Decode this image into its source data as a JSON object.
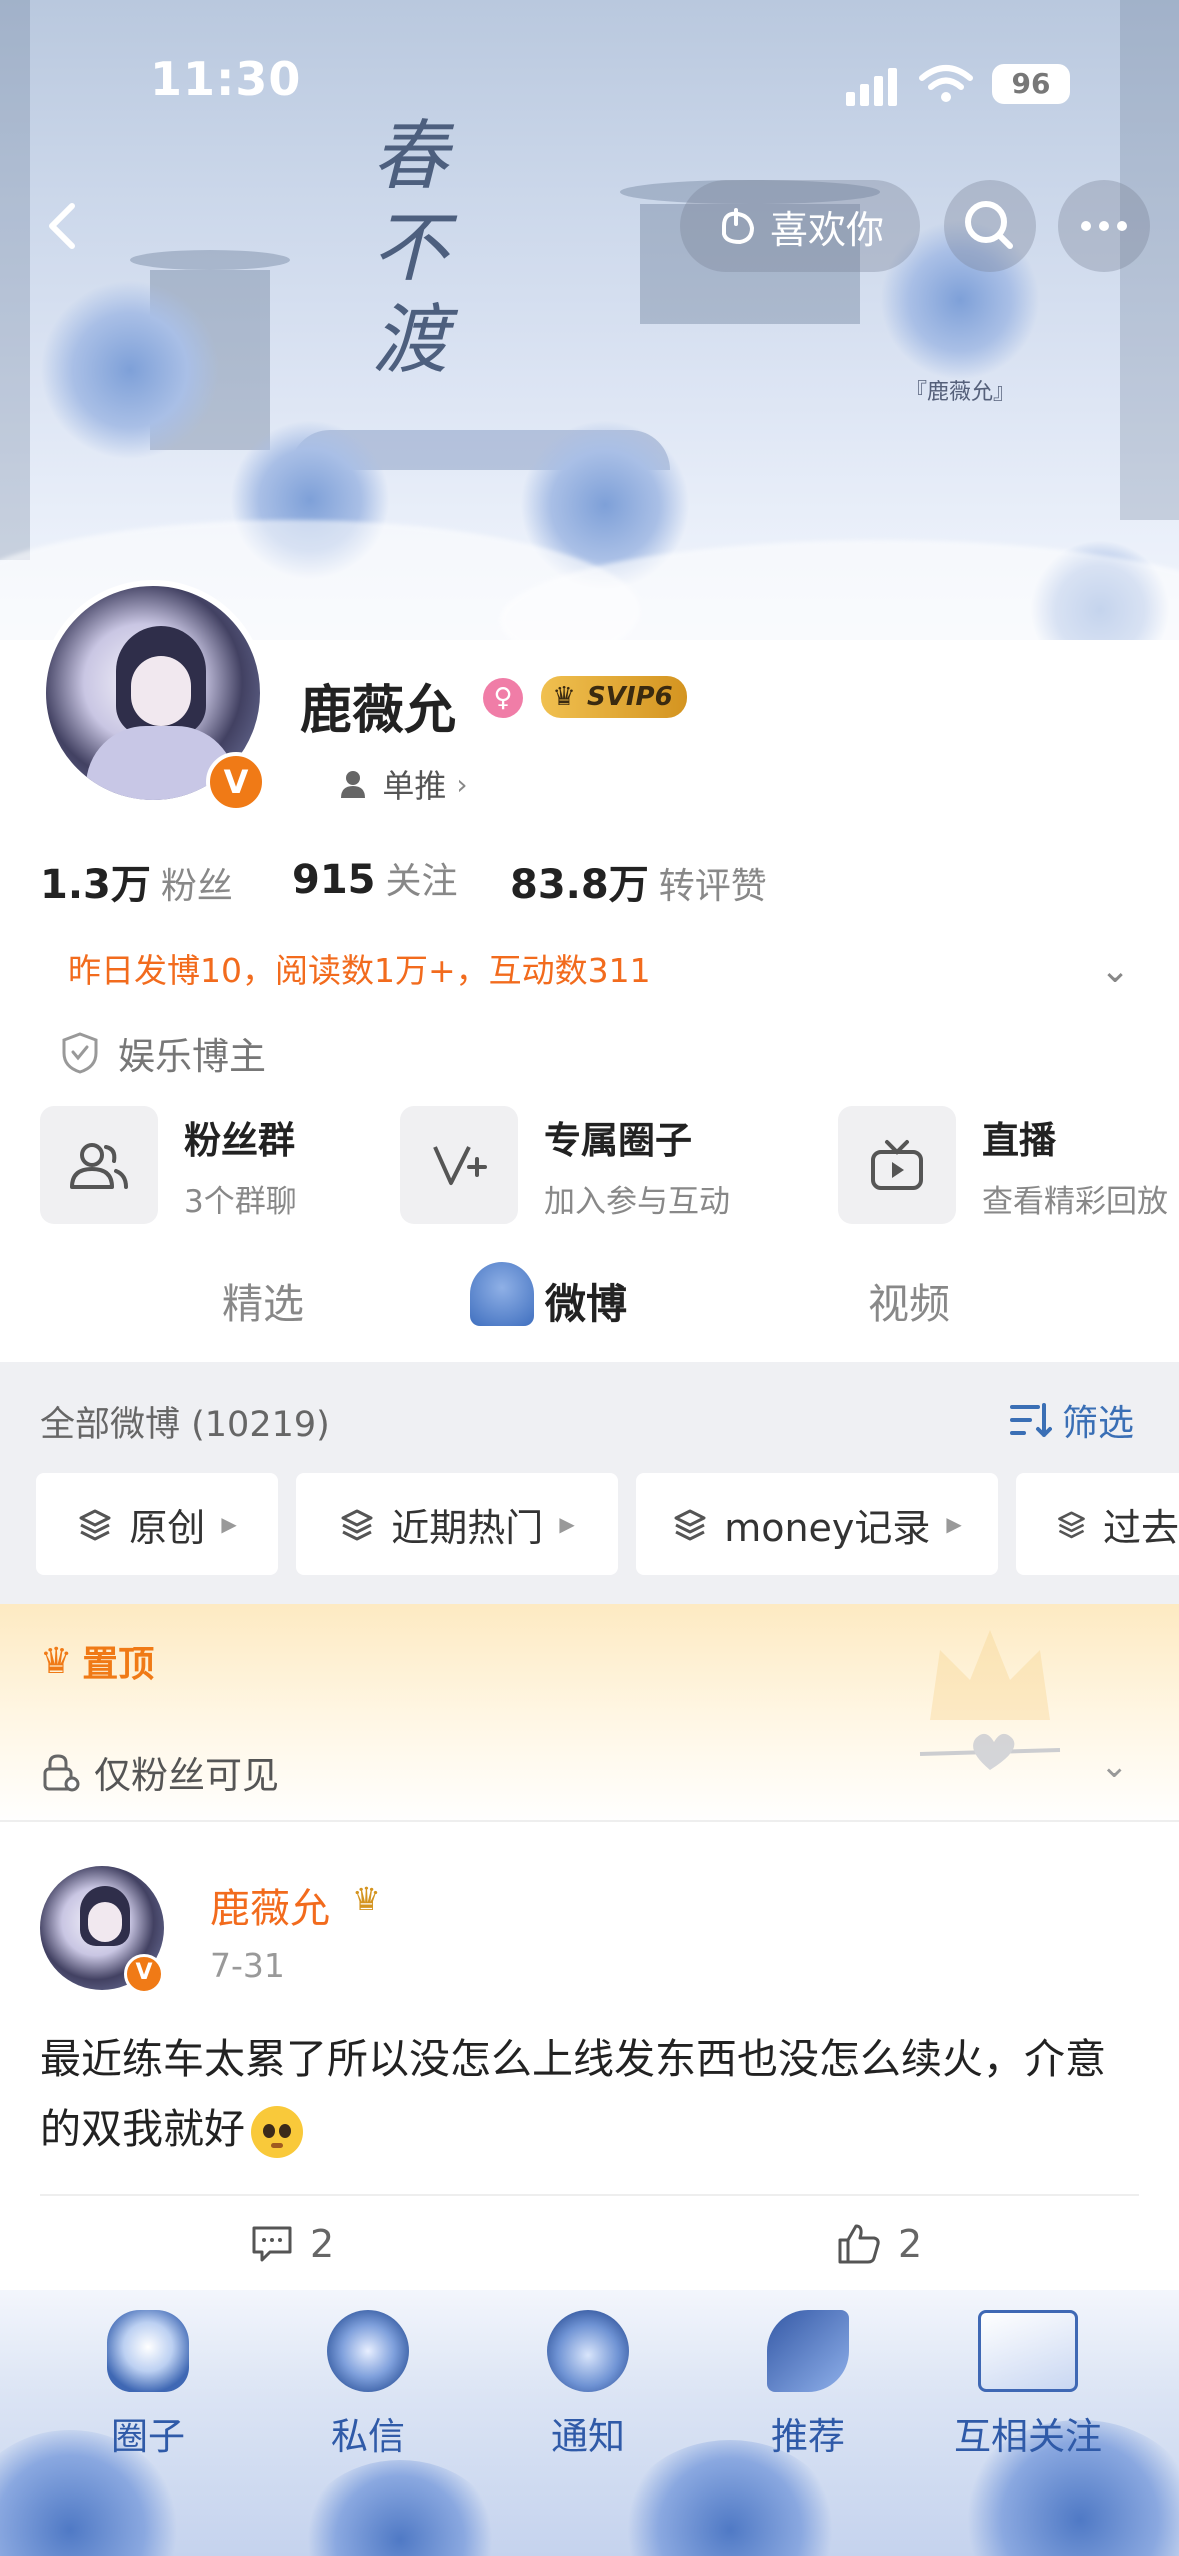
{
  "status_bar": {
    "time": "11:30",
    "battery": "96"
  },
  "header": {
    "like_label": "喜欢你"
  },
  "banner_calligraphy": {
    "title": "春不渡",
    "signature": "『鹿薇允』"
  },
  "profile": {
    "name": "鹿薇允",
    "gender_icon": "female-icon",
    "svip_label": "SVIP6",
    "single_label": "单推",
    "stats": [
      {
        "value": "1.3万",
        "label": "粉丝"
      },
      {
        "value": "915",
        "label": "关注"
      },
      {
        "value": "83.8万",
        "label": "转评赞"
      }
    ],
    "yesterday_summary": "昨日发博10，阅读数1万+，互动数311",
    "category": "娱乐博主"
  },
  "quick_actions": [
    {
      "title": "粉丝群",
      "subtitle": "3个群聊",
      "icon": "group-icon"
    },
    {
      "title": "专属圈子",
      "subtitle": "加入参与互动",
      "icon": "circle-plus-icon"
    },
    {
      "title": "直播",
      "subtitle": "查看精彩回放",
      "icon": "tv-icon"
    }
  ],
  "tabs": [
    {
      "label": "精选"
    },
    {
      "label": "微博",
      "active": true
    },
    {
      "label": "视频"
    }
  ],
  "feed": {
    "all_label": "全部微博 (10219)",
    "filter_label": "筛选",
    "chips": [
      {
        "label": "原创"
      },
      {
        "label": "近期热门"
      },
      {
        "label": "money记录"
      },
      {
        "label": "过去"
      }
    ],
    "pinned_label": "置顶",
    "fans_only_label": "仅粉丝可见"
  },
  "post": {
    "author": "鹿薇允",
    "date": "7-31",
    "text": "最近练车太累了所以没怎么上线发东西也没怎么续火，介意的双我就好",
    "comments": "2",
    "likes": "2"
  },
  "bottom_nav": [
    {
      "label": "圈子",
      "icon": "vase-icon"
    },
    {
      "label": "私信",
      "icon": "flower-icon"
    },
    {
      "label": "通知",
      "icon": "pouch-icon"
    },
    {
      "label": "推荐",
      "icon": "butterfly-icon"
    },
    {
      "label": "互相关注",
      "icon": "book-icon"
    }
  ],
  "colors": {
    "accent_orange": "#f26b1d",
    "link_blue": "#3a6fb5",
    "nav_blue": "#2f5aa8"
  }
}
